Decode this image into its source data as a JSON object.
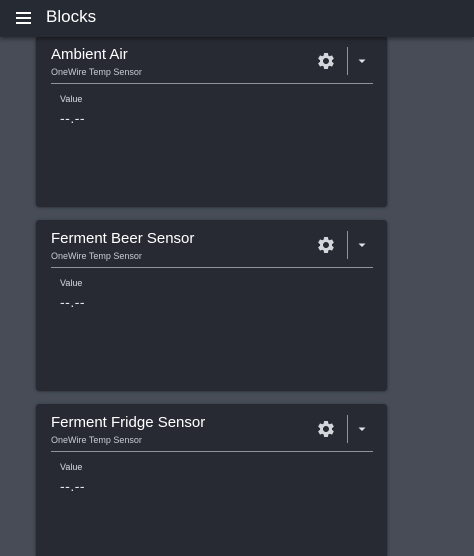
{
  "header": {
    "title": "Blocks",
    "menu_icon": "hamburger-menu-icon"
  },
  "colors": {
    "page_background": "#474c57",
    "header_background": "#262a33",
    "card_background": "#272a33",
    "separator": "#8e939c"
  },
  "cards": [
    {
      "title": "Ambient Air",
      "subtitle": "OneWire Temp Sensor",
      "value_label": "Value",
      "value": "--.--",
      "settings_icon": "gear-icon",
      "dropdown_icon": "caret-down-icon"
    },
    {
      "title": "Ferment Beer Sensor",
      "subtitle": "OneWire Temp Sensor",
      "value_label": "Value",
      "value": "--.--",
      "settings_icon": "gear-icon",
      "dropdown_icon": "caret-down-icon"
    },
    {
      "title": "Ferment Fridge Sensor",
      "subtitle": "OneWire Temp Sensor",
      "value_label": "Value",
      "value": "--.--",
      "settings_icon": "gear-icon",
      "dropdown_icon": "caret-down-icon"
    }
  ]
}
